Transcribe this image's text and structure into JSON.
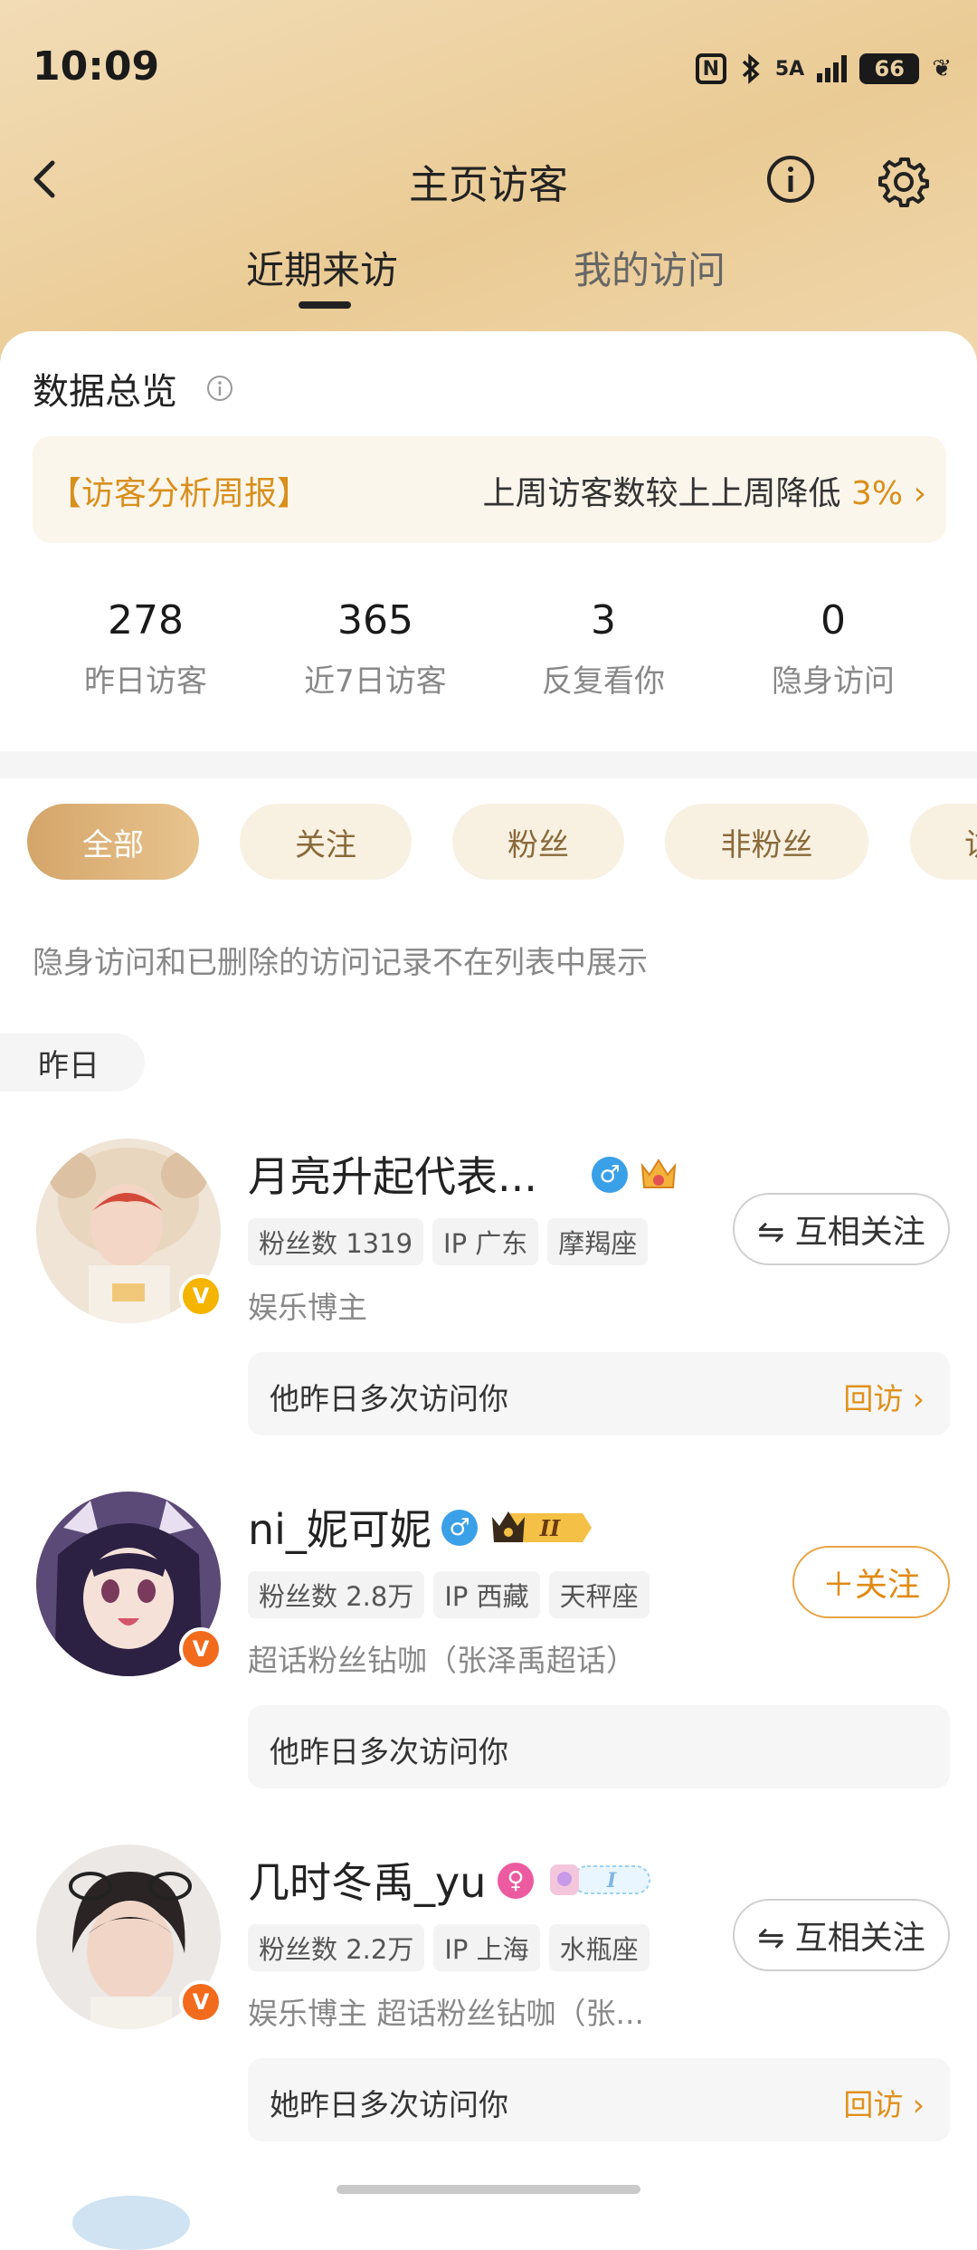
{
  "status": {
    "time": "10:09",
    "nfc": "N",
    "network": "5A",
    "battery": "66"
  },
  "header": {
    "title": "主页访客"
  },
  "tabs": [
    {
      "label": "近期来访"
    },
    {
      "label": "我的访问"
    }
  ],
  "overview": {
    "title": "数据总览",
    "report_label": "【访客分析周报】",
    "report_text": "上周访客数较上上周降低",
    "report_pct": "3%",
    "stats": [
      {
        "value": "278",
        "label": "昨日访客"
      },
      {
        "value": "365",
        "label": "近7日访客"
      },
      {
        "value": "3",
        "label": "反复看你"
      },
      {
        "value": "0",
        "label": "隐身访问"
      }
    ]
  },
  "filters": [
    "全部",
    "关注",
    "粉丝",
    "非粉丝",
    "访"
  ],
  "note": "隐身访问和已删除的访问记录不在列表中展示",
  "section_label": "昨日",
  "visitors": [
    {
      "name": "月亮升起代表...",
      "tags": [
        "粉丝数 1319",
        "IP 广东",
        "摩羯座"
      ],
      "desc": "娱乐博主",
      "button": "⇋ 互相关注",
      "visit_text": "他昨日多次访问你",
      "revisit": "回访 ›"
    },
    {
      "name": "ni_妮可妮",
      "tags": [
        "粉丝数 2.8万",
        "IP 西藏",
        "天秤座"
      ],
      "desc": "超话粉丝钻咖（张泽禹超话）",
      "button": "＋关注",
      "visit_text": "他昨日多次访问你",
      "revisit": ""
    },
    {
      "name": "几时冬禹_yu",
      "tags": [
        "粉丝数 2.2万",
        "IP 上海",
        "水瓶座"
      ],
      "desc": "娱乐博主 超话粉丝钻咖（张...",
      "button": "⇋ 互相关注",
      "visit_text": "她昨日多次访问你",
      "revisit": "回访 ›"
    }
  ],
  "colors": {
    "accent": "#e0901a",
    "header_bg": "#eacb95",
    "male": "#3aa0e8",
    "female": "#ec5aa0",
    "verified_gold": "#f5b400",
    "verified_orange": "#f26b1d"
  }
}
